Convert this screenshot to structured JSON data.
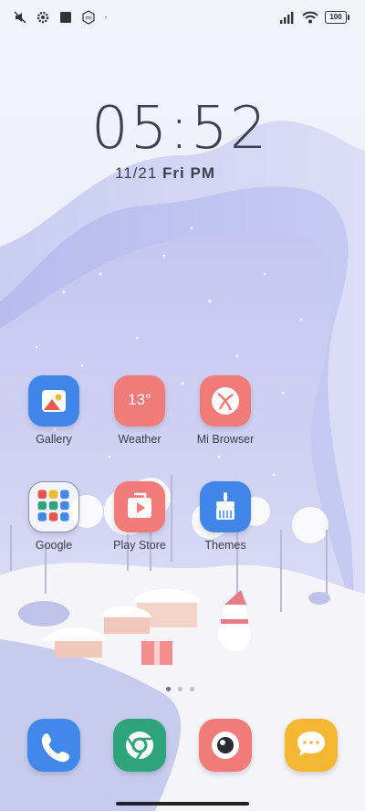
{
  "status_bar": {
    "left_icons": [
      "mute-icon",
      "settings-icon",
      "square-icon",
      "mi-icon",
      "dot-icon"
    ],
    "right_icons": [
      "signal-icon",
      "wifi-icon"
    ],
    "battery": "100"
  },
  "lockclock": {
    "time": "05:52",
    "date": "11/21",
    "day": "Fri",
    "ampm": "PM"
  },
  "apps": [
    {
      "label": "Gallery",
      "icon": "gallery-icon",
      "color": "#3f86e8"
    },
    {
      "label": "Weather",
      "icon": "weather-icon",
      "color": "#f07b78",
      "temp": "13°"
    },
    {
      "label": "Mi Browser",
      "icon": "browser-icon",
      "color": "#f07b78"
    },
    {
      "label": "Google",
      "icon": "folder-icon",
      "color": "#f3f3f6"
    },
    {
      "label": "Play Store",
      "icon": "play-store-icon",
      "color": "#f07b78"
    },
    {
      "label": "Themes",
      "icon": "themes-icon",
      "color": "#3f86e8"
    }
  ],
  "dock": [
    {
      "name": "phone",
      "icon": "phone-icon",
      "color": "#4287ea"
    },
    {
      "name": "chrome",
      "icon": "chrome-icon",
      "color": "#2fa37c"
    },
    {
      "name": "camera",
      "icon": "camera-icon",
      "color": "#f07b78"
    },
    {
      "name": "messages",
      "icon": "message-icon",
      "color": "#f4b731"
    }
  ],
  "pager": {
    "pages": 3,
    "current": 1
  }
}
